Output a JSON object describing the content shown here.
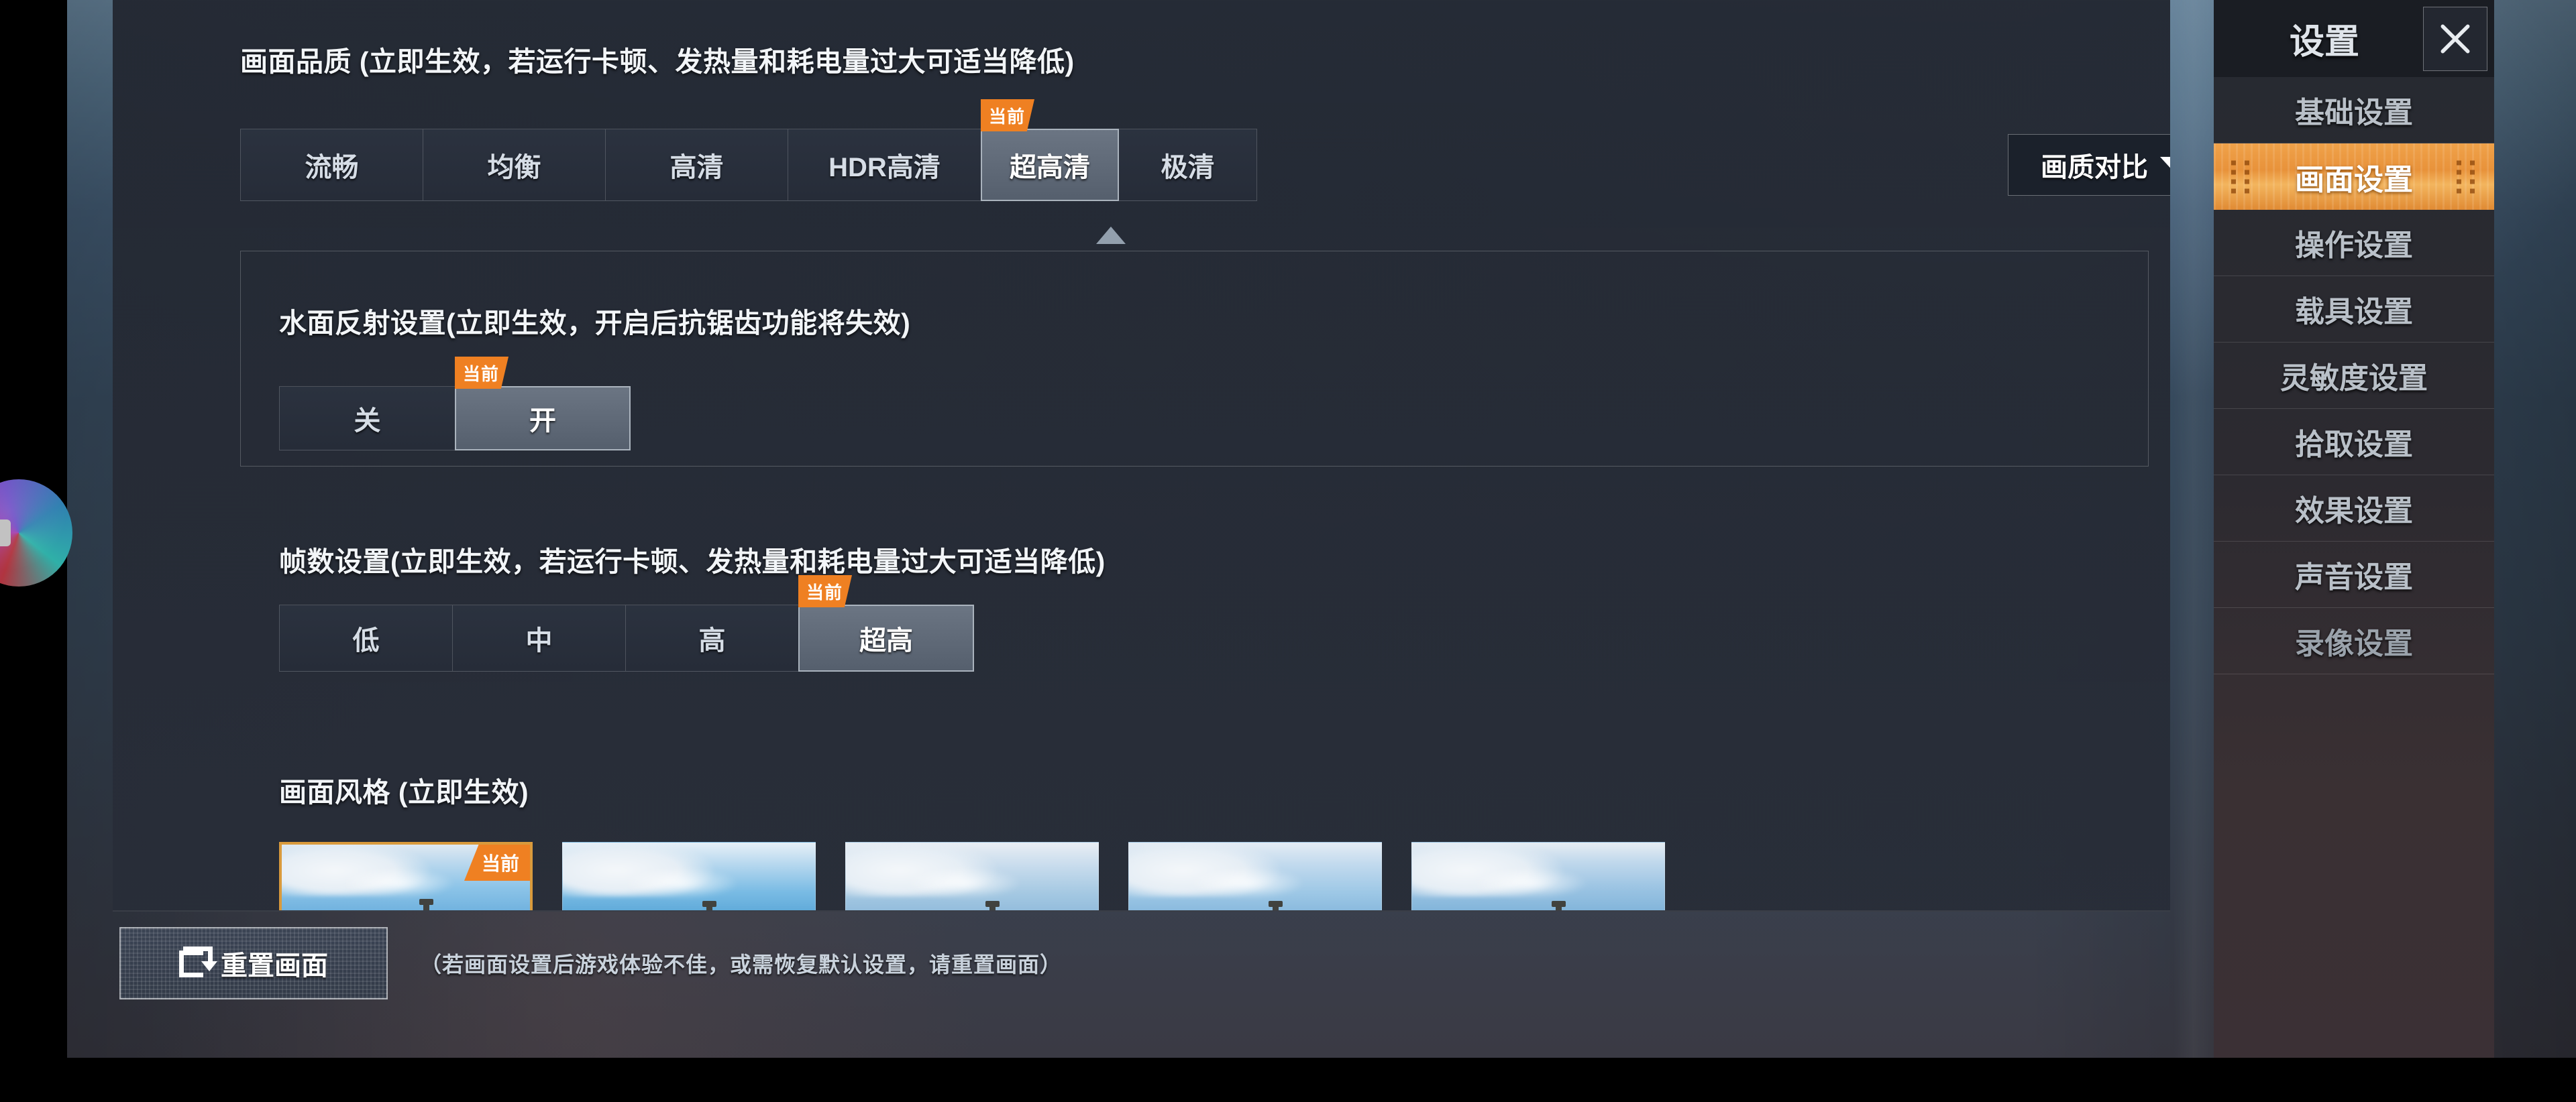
{
  "sidebar": {
    "title": "设置",
    "close_icon": "close-icon",
    "items": [
      {
        "label": "基础设置",
        "active": false
      },
      {
        "label": "画面设置",
        "active": true
      },
      {
        "label": "操作设置",
        "active": false
      },
      {
        "label": "载具设置",
        "active": false
      },
      {
        "label": "灵敏度设置",
        "active": false
      },
      {
        "label": "拾取设置",
        "active": false
      },
      {
        "label": "效果设置",
        "active": false
      },
      {
        "label": "声音设置",
        "active": false
      },
      {
        "label": "录像设置",
        "active": false
      }
    ]
  },
  "main": {
    "graphics_quality": {
      "title": "画面品质 (立即生效，若运行卡顿、发热量和耗电量过大可适当降低)",
      "options": [
        "流畅",
        "均衡",
        "高清",
        "HDR高清",
        "超高清",
        "极清"
      ],
      "selected": "超高清",
      "current_badge": "当前"
    },
    "compare_button": {
      "label": "画质对比",
      "caret_icon": "chevron-down-icon"
    },
    "water_reflection": {
      "title": "水面反射设置(立即生效，开启后抗锯齿功能将失效)",
      "options": [
        "关",
        "开"
      ],
      "selected": "开",
      "current_badge": "当前"
    },
    "frame_rate": {
      "title": "帧数设置(立即生效，若运行卡顿、发热量和耗电量过大可适当降低)",
      "options": [
        "低",
        "中",
        "高",
        "超高"
      ],
      "selected": "超高",
      "current_badge": "当前"
    },
    "picture_style": {
      "title": "画面风格 (立即生效)",
      "thumbnails": [
        {
          "name": "style-1",
          "selected": true
        },
        {
          "name": "style-2",
          "selected": false
        },
        {
          "name": "style-3",
          "selected": false
        },
        {
          "name": "style-4",
          "selected": false
        },
        {
          "name": "style-5",
          "selected": false
        }
      ],
      "current_badge": "当前"
    }
  },
  "footer": {
    "reset_button": "重置画面",
    "note": "（若画面设置后游戏体验不佳，或需恢复默认设置，请重置画面）"
  },
  "colors": {
    "accent_orange": "#ef8022",
    "sidebar_active": "#e8923a",
    "panel_bg": "#282d38",
    "selected_segment": "#6b7583"
  }
}
